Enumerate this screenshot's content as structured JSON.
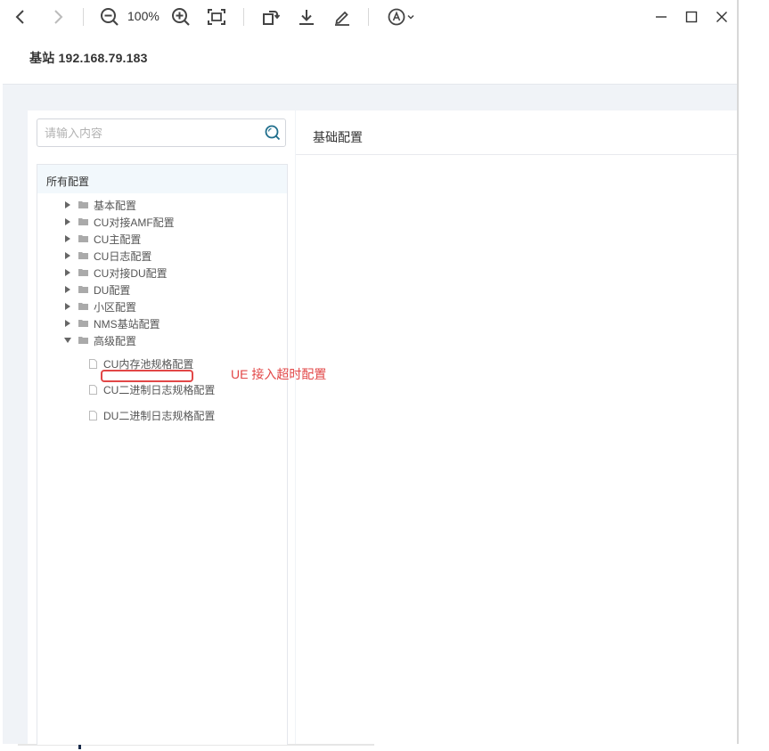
{
  "toolbar": {
    "zoom": "100%",
    "icons": [
      "back-icon",
      "forward-icon",
      "zoom-out-icon",
      "zoom-in-icon",
      "fit-page-icon",
      "rotate-icon",
      "download-icon",
      "annotate-pen-icon",
      "read-aloud-icon",
      "chevron-down-icon",
      "minimize-icon",
      "maximize-icon",
      "close-icon"
    ]
  },
  "header": {
    "title": "基站 192.168.79.183"
  },
  "search": {
    "placeholder": "请输入内容",
    "value": ""
  },
  "tree": {
    "root_label": "所有配置",
    "items": [
      {
        "label": "基本配置",
        "expanded": false
      },
      {
        "label": "CU对接AMF配置",
        "expanded": false
      },
      {
        "label": "CU主配置",
        "expanded": false
      },
      {
        "label": "CU日志配置",
        "expanded": false
      },
      {
        "label": "CU对接DU配置",
        "expanded": false
      },
      {
        "label": "DU配置",
        "expanded": false
      },
      {
        "label": "小区配置",
        "expanded": false
      },
      {
        "label": "NMS基站配置",
        "expanded": false
      },
      {
        "label": "高级配置",
        "expanded": true
      }
    ],
    "children": [
      {
        "label": "CU内存池规格配置"
      },
      {
        "label": "CU二进制日志规格配置"
      },
      {
        "label": "DU二进制日志规格配置"
      }
    ]
  },
  "main": {
    "title": "基础配置"
  },
  "annotation": {
    "text": "UE 接入超时配置",
    "color": "#e24747"
  },
  "colors": {
    "tree_header_bg": "#f2f8fc",
    "content_bg": "#f0f3f7",
    "search_icon": "#1f6e8c"
  }
}
